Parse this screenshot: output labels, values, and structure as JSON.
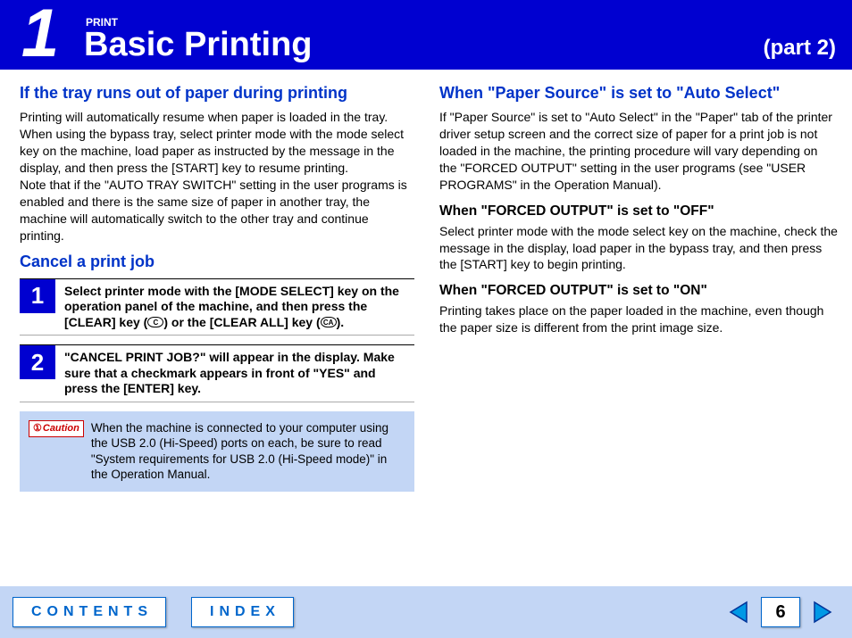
{
  "header": {
    "chapter_number": "1",
    "small_title": "PRINT",
    "main_title": "Basic Printing",
    "part_label": "(part 2)"
  },
  "left": {
    "h1": "If the tray runs out of paper during printing",
    "p1": "Printing will automatically resume when paper is loaded in the tray.\nWhen using the bypass tray, select printer mode with the mode select key on the machine, load paper as instructed by the message in the display, and then press the [START] key to resume printing.\nNote that if the \"AUTO TRAY SWITCH\" setting in the user programs is enabled and there is the same size of paper in another tray, the machine will automatically switch to the other tray and continue printing.",
    "h2": "Cancel a print job",
    "steps": [
      {
        "num": "1",
        "text_a": "Select printer mode with the [MODE SELECT] key on the operation panel of the machine, and then press the [CLEAR] key (",
        "text_b": ") or the [CLEAR ALL] key (",
        "text_c": ").",
        "key1": "C",
        "key2": "CA"
      },
      {
        "num": "2",
        "text": "\"CANCEL PRINT JOB?\" will appear in the display. Make sure that a checkmark appears in front of \"YES\" and press the [ENTER] key."
      }
    ],
    "caution": {
      "label": "Caution",
      "text": "When the machine is connected to your computer using the USB 2.0 (Hi-Speed) ports on each, be sure to read \"System requirements for USB 2.0 (Hi-Speed mode)\" in the Operation Manual."
    }
  },
  "right": {
    "h1": "When \"Paper Source\" is set to \"Auto Select\"",
    "p1": "If \"Paper Source\" is set to \"Auto Select\" in the \"Paper\" tab of the printer driver setup screen and the correct size of paper for a print job is not loaded in the machine, the printing procedure will vary depending on the \"FORCED OUTPUT\" setting in the user programs (see \"USER PROGRAMS\" in the Operation Manual).",
    "h2": "When \"FORCED OUTPUT\" is set to \"OFF\"",
    "p2": "Select printer mode with the mode select key on the machine, check the message in the display, load paper in the bypass tray, and then press the [START] key to begin printing.",
    "h3": "When \"FORCED OUTPUT\" is set to \"ON\"",
    "p3": "Printing takes place on the paper loaded in the machine, even though the paper size is different from the print image size."
  },
  "footer": {
    "contents": "CONTENTS",
    "index": "INDEX",
    "page": "6"
  }
}
